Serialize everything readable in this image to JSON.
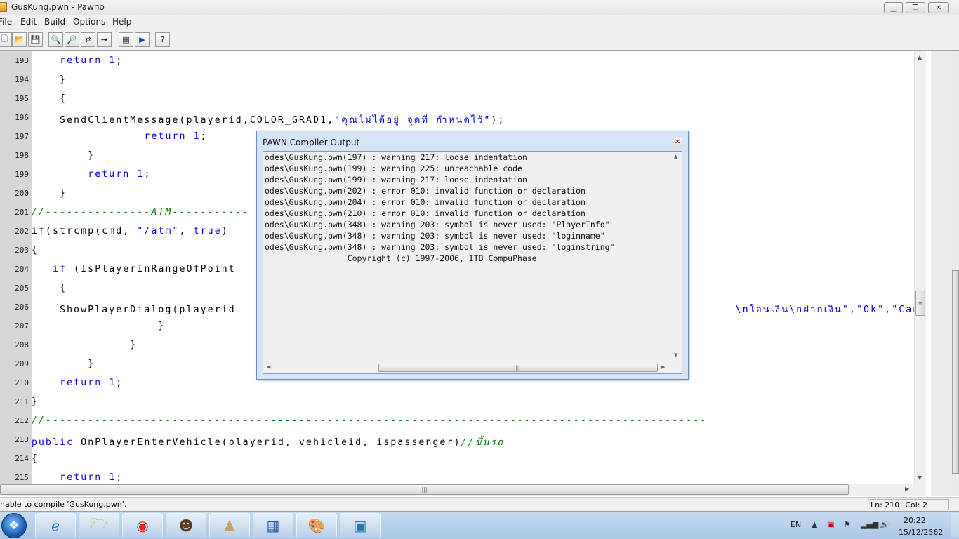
{
  "window": {
    "title": "GusKung.pwn - Pawno",
    "controls": {
      "minimize": "▁",
      "maximize": "❐",
      "close": "✕"
    }
  },
  "menu": [
    "File",
    "Edit",
    "Build",
    "Options",
    "Help"
  ],
  "toolbar": {
    "buttons": [
      {
        "name": "new-file-icon",
        "glyph": "🗋"
      },
      {
        "name": "open-file-icon",
        "glyph": "📂"
      },
      {
        "name": "save-file-icon",
        "glyph": "💾"
      },
      {
        "name": "find-icon",
        "glyph": "🔍"
      },
      {
        "name": "find-next-icon",
        "glyph": "🔎"
      },
      {
        "name": "replace-icon",
        "glyph": "⇄"
      },
      {
        "name": "goto-line-icon",
        "glyph": "⇥"
      },
      {
        "name": "function-list-icon",
        "glyph": "▤"
      },
      {
        "name": "compile-run-icon",
        "glyph": "▶"
      },
      {
        "name": "help-icon",
        "glyph": "?"
      }
    ]
  },
  "editor": {
    "line_numbers": [
      "193",
      "194",
      "195",
      "196",
      "197",
      "198",
      "199",
      "200",
      "201",
      "202",
      "203",
      "204",
      "205",
      "206",
      "207",
      "208",
      "209",
      "210",
      "211",
      "212",
      "213",
      "214",
      "215"
    ],
    "lines": [
      {
        "parts": [
          [
            "    ",
            "t"
          ],
          [
            "return",
            "kw"
          ],
          [
            " ",
            "t"
          ],
          [
            "1",
            "num"
          ],
          [
            ";",
            "t"
          ]
        ]
      },
      {
        "parts": [
          [
            "    }",
            "t"
          ]
        ]
      },
      {
        "parts": [
          [
            "    {",
            "t"
          ]
        ]
      },
      {
        "parts": [
          [
            "    SendClientMessage(playerid,COLOR_GRAD1,",
            "t"
          ],
          [
            "\"คุณไม่ได้อยู่ จุดที่ กำหนดไว้\"",
            "str"
          ],
          [
            ");",
            "t"
          ]
        ]
      },
      {
        "parts": [
          [
            "                ",
            "t"
          ],
          [
            "return",
            "kw"
          ],
          [
            " ",
            "t"
          ],
          [
            "1",
            "num"
          ],
          [
            ";",
            "t"
          ]
        ]
      },
      {
        "parts": [
          [
            "        }",
            "t"
          ]
        ]
      },
      {
        "parts": [
          [
            "        ",
            "t"
          ],
          [
            "return",
            "kw"
          ],
          [
            " ",
            "t"
          ],
          [
            "1",
            "num"
          ],
          [
            ";",
            "t"
          ]
        ]
      },
      {
        "parts": [
          [
            "    }",
            "t"
          ]
        ]
      },
      {
        "parts": [
          [
            "//---------------ATM-----------",
            "cmt"
          ]
        ]
      },
      {
        "parts": [
          [
            "if(strcmp(cmd, ",
            "t"
          ],
          [
            "\"/atm\"",
            "str"
          ],
          [
            ", ",
            "t"
          ],
          [
            "true",
            "kw"
          ],
          [
            ")",
            "t"
          ]
        ]
      },
      {
        "parts": [
          [
            "{",
            "t"
          ]
        ]
      },
      {
        "parts": [
          [
            "   ",
            "t"
          ],
          [
            "if",
            "kw"
          ],
          [
            " (IsPlayerInRangeOfPoint",
            "t"
          ]
        ]
      },
      {
        "parts": [
          [
            "    {",
            "t"
          ]
        ]
      },
      {
        "parts": [
          [
            "    ShowPlayerDialog(playerid",
            "t"
          ],
          [
            "                                                                       \\nโอนเงิน\\nฝากเงิน\"",
            "str"
          ],
          [
            ",",
            "t"
          ],
          [
            "\"Ok\"",
            "str"
          ],
          [
            ",",
            "t"
          ],
          [
            "\"Can",
            "str"
          ]
        ]
      },
      {
        "parts": [
          [
            "                  }",
            "t"
          ]
        ]
      },
      {
        "parts": [
          [
            "              }",
            "t"
          ]
        ]
      },
      {
        "parts": [
          [
            "        }",
            "t"
          ]
        ]
      },
      {
        "parts": [
          [
            "    ",
            "t"
          ],
          [
            "return",
            "kw"
          ],
          [
            " ",
            "t"
          ],
          [
            "1",
            "num"
          ],
          [
            ";",
            "t"
          ]
        ]
      },
      {
        "parts": [
          [
            "}",
            "t"
          ]
        ]
      },
      {
        "parts": [
          [
            "//----------------------------------------------------------------------------------------------",
            "cmt"
          ]
        ]
      },
      {
        "parts": [
          [
            "public",
            "kw"
          ],
          [
            " OnPlayerEnterVehicle(playerid, vehicleid, ispassenger)",
            "t"
          ],
          [
            "//ขึ้นรถ",
            "cmt"
          ]
        ]
      },
      {
        "parts": [
          [
            "{",
            "t"
          ]
        ]
      },
      {
        "parts": [
          [
            "    ",
            "t"
          ],
          [
            "return",
            "kw"
          ],
          [
            " ",
            "t"
          ],
          [
            "1",
            "num"
          ],
          [
            ";",
            "t"
          ]
        ]
      }
    ]
  },
  "compiler_dialog": {
    "title": "PAWN Compiler Output",
    "close_glyph": "✕",
    "lines": [
      "odes\\GusKung.pwn(197) : warning 217: loose indentation",
      "odes\\GusKung.pwn(199) : warning 225: unreachable code",
      "odes\\GusKung.pwn(199) : warning 217: loose indentation",
      "odes\\GusKung.pwn(202) : error 010: invalid function or declaration",
      "odes\\GusKung.pwn(204) : error 010: invalid function or declaration",
      "odes\\GusKung.pwn(210) : error 010: invalid function or declaration",
      "odes\\GusKung.pwn(348) : warning 203: symbol is never used: \"PlayerInfo\"",
      "odes\\GusKung.pwn(348) : warning 203: symbol is never used: \"loginname\"",
      "odes\\GusKung.pwn(348) : warning 203: symbol is never used: \"loginstring\"",
      "                 Copyright (c) 1997-2006, ITB CompuPhase"
    ]
  },
  "status": {
    "message": "nable to compile 'GusKung.pwn'.",
    "line": "Ln: 210",
    "col": "Col: 2"
  },
  "taskbar": {
    "start_glyph": "❖",
    "apps": [
      {
        "name": "internet-explorer-icon",
        "glyph": "ℯ",
        "color": "#1e6fd6"
      },
      {
        "name": "file-explorer-icon",
        "glyph": "🗁",
        "color": "#d9a520"
      },
      {
        "name": "chrome-icon",
        "glyph": "◉",
        "color": "#d93025"
      },
      {
        "name": "game-avatar-icon",
        "glyph": "☻",
        "color": "#5a3a1a"
      },
      {
        "name": "pawn-chess-icon",
        "glyph": "♟",
        "color": "#c8a060"
      },
      {
        "name": "pawno-editor-icon",
        "glyph": "▦",
        "color": "#2a5d9f"
      },
      {
        "name": "paint-icon",
        "glyph": "🎨",
        "color": "#c05020"
      },
      {
        "name": "photo-viewer-icon",
        "glyph": "▣",
        "color": "#2a7aa8"
      }
    ],
    "language": "EN",
    "time": "20:22",
    "date": "15/12/2562"
  }
}
